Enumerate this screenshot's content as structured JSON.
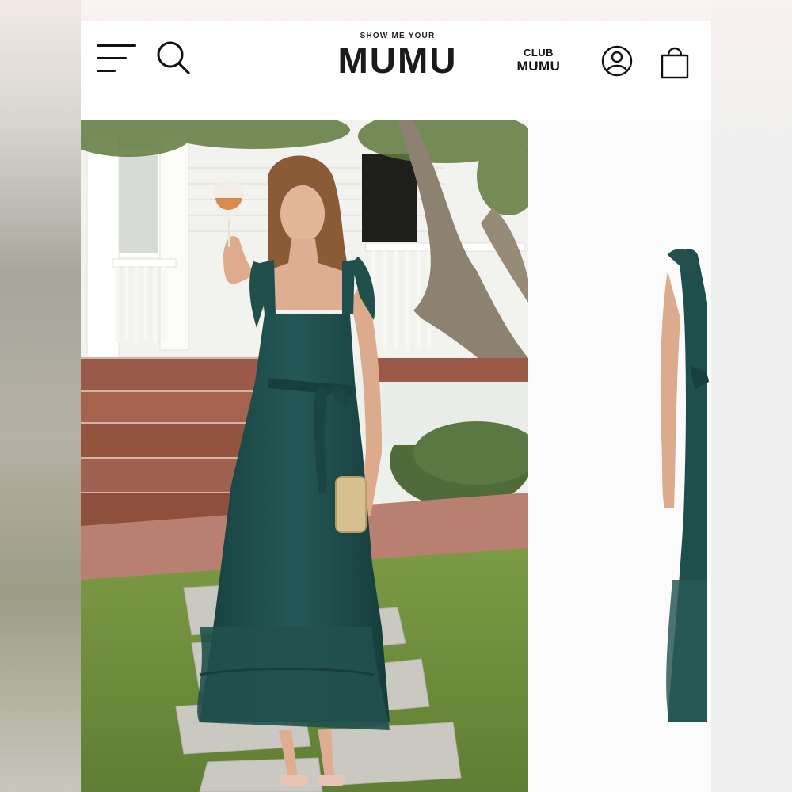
{
  "header": {
    "logo_small": "SHOW ME YOUR",
    "logo_big": "MUMU",
    "club_top": "CLUB",
    "club_bottom": "MUMU"
  },
  "icons": {
    "menu": "hamburger-menu-icon",
    "search": "search-icon",
    "account": "account-icon",
    "cart": "shopping-bag-icon"
  },
  "gallery": {
    "main_image": "model in green tie-strap maxi dress holding wine glass on brick steps",
    "side_image": "green dress side view on white background"
  },
  "colors": {
    "dress": "#1f4f4d",
    "header_bg": "#ffffff",
    "text": "#111111"
  }
}
